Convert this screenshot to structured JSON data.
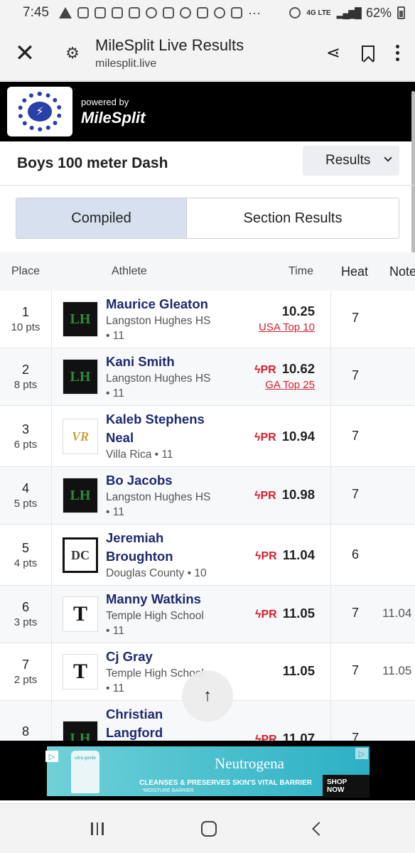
{
  "status": {
    "time": "7:45",
    "battery": "62%",
    "network": "4G LTE"
  },
  "browser": {
    "title": "MileSplit Live Results",
    "url": "milesplit.live"
  },
  "site": {
    "powered_by": "powered by",
    "brand": "MileSplit"
  },
  "event": {
    "title": "Boys 100 meter Dash",
    "view_select": "Results"
  },
  "tabs": [
    {
      "label": "Compiled",
      "active": true
    },
    {
      "label": "Section Results",
      "active": false
    }
  ],
  "table": {
    "headers": {
      "place": "Place",
      "athlete": "Athlete",
      "time": "Time",
      "heat": "Heat",
      "note": "Note"
    },
    "rows": [
      {
        "place": "1",
        "pts": "10 pts",
        "logo": "LH",
        "name": [
          "Maurice Gleaton"
        ],
        "school": [
          "Langston Hughes HS",
          "• 11"
        ],
        "pr": "",
        "time": "10.25",
        "tag": "USA Top 10",
        "heat": "7",
        "note": ""
      },
      {
        "place": "2",
        "pts": "8 pts",
        "logo": "LH",
        "name": [
          "Kani Smith"
        ],
        "school": [
          "Langston Hughes HS",
          "• 11"
        ],
        "pr": "PR",
        "time": "10.62",
        "tag": "GA Top 25",
        "heat": "7",
        "note": ""
      },
      {
        "place": "3",
        "pts": "6 pts",
        "logo": "VR",
        "name": [
          "Kaleb Stephens",
          "Neal"
        ],
        "school": [
          "Villa Rica • 11"
        ],
        "pr": "PR",
        "time": "10.94",
        "tag": "",
        "heat": "7",
        "note": ""
      },
      {
        "place": "4",
        "pts": "5 pts",
        "logo": "LH",
        "name": [
          "Bo Jacobs"
        ],
        "school": [
          "Langston Hughes HS",
          "• 11"
        ],
        "pr": "PR",
        "time": "10.98",
        "tag": "",
        "heat": "7",
        "note": ""
      },
      {
        "place": "5",
        "pts": "4 pts",
        "logo": "DC",
        "name": [
          "Jeremiah",
          "Broughton"
        ],
        "school": [
          "Douglas County • 10"
        ],
        "pr": "PR",
        "time": "11.04",
        "tag": "",
        "heat": "6",
        "note": ""
      },
      {
        "place": "6",
        "pts": "3 pts",
        "logo": "T",
        "name": [
          "Manny Watkins"
        ],
        "school": [
          "Temple High School",
          "• 11"
        ],
        "pr": "PR",
        "time": "11.05",
        "tag": "",
        "heat": "7",
        "note": "11.04"
      },
      {
        "place": "7",
        "pts": "2 pts",
        "logo": "T",
        "name": [
          "Cj Gray"
        ],
        "school": [
          "Temple High School",
          "• 11"
        ],
        "pr": "",
        "time": "11.05",
        "tag": "",
        "heat": "7",
        "note": "11.05"
      },
      {
        "place": "8",
        "pts": "",
        "logo": "LH",
        "name": [
          "Christian",
          "Langford"
        ],
        "school": [],
        "pr": "PR",
        "time": "11.07",
        "tag": "",
        "heat": "7",
        "note": ""
      }
    ]
  },
  "ad": {
    "brand": "Neutrogena",
    "tagline": "CLEANSES & PRESERVES SKIN'S VITAL BARRIER",
    "sub": "*MOISTURE BARRIER",
    "cta": "SHOP NOW",
    "product": "ultra gentle"
  },
  "icons": {
    "close": "close-icon",
    "tune": "tune-icon",
    "share": "share-icon",
    "bookmark": "bookmark-icon",
    "menu": "more-vert-icon",
    "up": "arrow-up-icon"
  }
}
